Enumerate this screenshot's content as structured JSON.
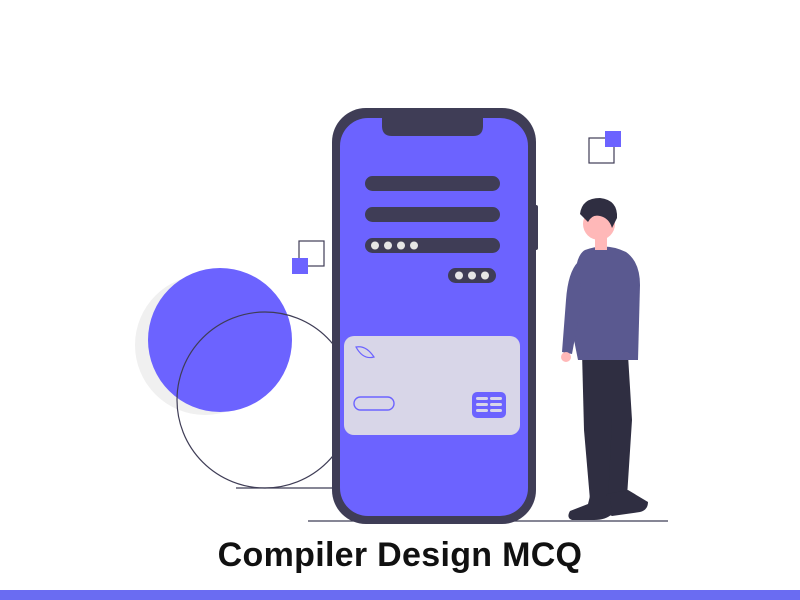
{
  "title": "Compiler Design MCQ",
  "colors": {
    "accent": "#6c63ff",
    "dark": "#3f3d56",
    "card": "#d6d3e8",
    "skin": "#ffb8b8",
    "pants": "#2f2e41",
    "shirt": "#5a5990",
    "circle_shadow": "#f2f2f2",
    "bottom_bar": "#6a6cf2"
  }
}
